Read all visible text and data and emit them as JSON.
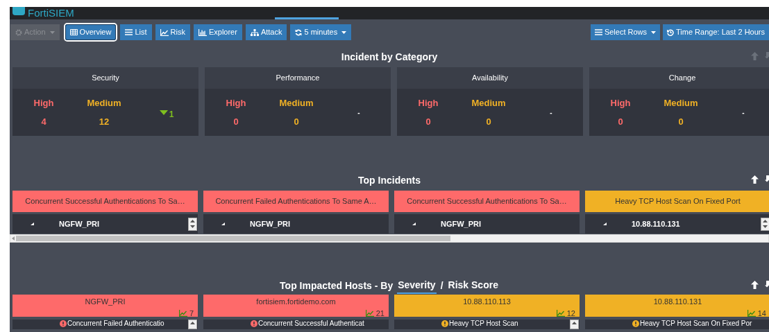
{
  "header": {
    "logo_text": "FortiSIEM"
  },
  "toolbar": {
    "left": [
      {
        "label": "Action",
        "disabled": true,
        "selected": false,
        "caret": true
      },
      {
        "label": "Overview",
        "disabled": false,
        "selected": true,
        "caret": false
      },
      {
        "label": "List",
        "disabled": false,
        "selected": false,
        "caret": false
      },
      {
        "label": "Risk",
        "disabled": false,
        "selected": false,
        "caret": false
      },
      {
        "label": "Explorer",
        "disabled": false,
        "selected": false,
        "caret": false
      },
      {
        "label": "Attack",
        "disabled": false,
        "selected": false,
        "caret": false
      },
      {
        "label": "5 minutes",
        "disabled": false,
        "selected": false,
        "caret": true
      }
    ],
    "right": [
      {
        "label": "Select Rows",
        "caret": true
      },
      {
        "label": "Time Range: Last 2 Hours",
        "caret": false
      }
    ]
  },
  "incident_by_category": {
    "title": "Incident by Category",
    "cards": [
      {
        "title": "Security",
        "high_label": "High",
        "high": "4",
        "medium_label": "Medium",
        "medium": "12",
        "kind": "down",
        "trend_value": "1"
      },
      {
        "title": "Performance",
        "high_label": "High",
        "high": "0",
        "medium_label": "Medium",
        "medium": "0",
        "kind": "flat",
        "trend_value": "-"
      },
      {
        "title": "Availability",
        "high_label": "High",
        "high": "0",
        "medium_label": "Medium",
        "medium": "0",
        "kind": "flat",
        "trend_value": "-"
      },
      {
        "title": "Change",
        "high_label": "High",
        "high": "0",
        "medium_label": "Medium",
        "medium": "0",
        "kind": "flat",
        "trend_value": "-"
      }
    ]
  },
  "top_incidents": {
    "title": "Top Incidents",
    "cards": [
      {
        "title": "Concurrent Successful Authentications To Sa…",
        "color": "#fe6a6a",
        "host": "NGFW_PRI",
        "scroll": true
      },
      {
        "title": "Concurrent Failed Authentications To Same A…",
        "color": "#fe6a6a",
        "host": "NGFW_PRI",
        "scroll": false
      },
      {
        "title": "Concurrent Successful Authentications To Sa…",
        "color": "#fe6a6a",
        "host": "NGFW_PRI",
        "scroll": false
      },
      {
        "title": "Heavy TCP Host Scan On Fixed Port",
        "color": "#f0b125",
        "host": "10.88.110.131",
        "scroll": true
      }
    ]
  },
  "top_impacted_hosts": {
    "title": "Top Impacted Hosts - By",
    "separator": "/",
    "options": [
      {
        "label": "Severity",
        "selected": true
      },
      {
        "label": "Risk Score",
        "selected": false
      }
    ],
    "cards": [
      {
        "host": "NGFW_PRI",
        "color": "#fe6a6a",
        "count": "7",
        "incident": "Concurrent Failed Authenticatio",
        "scroll": true
      },
      {
        "host": "fortisiem.fortidemo.com",
        "color": "#fe6a6a",
        "count": "21",
        "incident": "Concurrent Successful Authenticat",
        "scroll": false
      },
      {
        "host": "10.88.110.113",
        "color": "#f0b125",
        "count": "12",
        "incident": "Heavy TCP Host Scan",
        "scroll": true
      },
      {
        "host": "10.88.110.131",
        "color": "#f0b125",
        "count": "14",
        "incident": "Heavy TCP Host Scan On Fixed Por",
        "scroll": false
      }
    ]
  }
}
